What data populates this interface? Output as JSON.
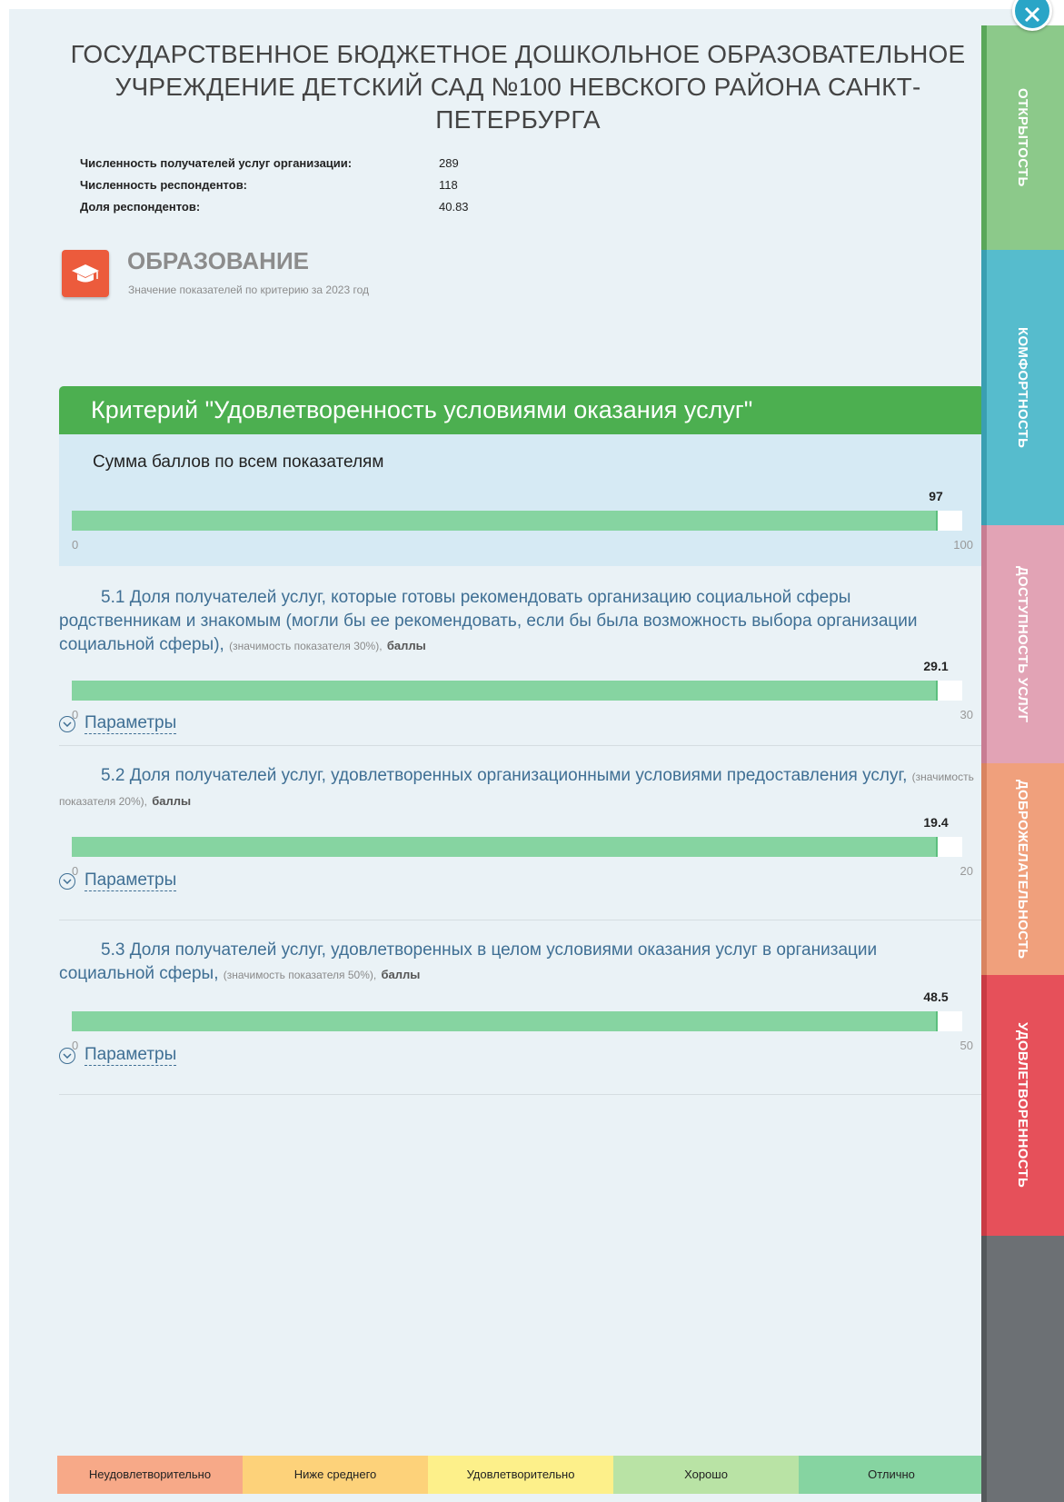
{
  "organization": {
    "title": "ГОСУДАРСТВЕННОЕ БЮДЖЕТНОЕ ДОШКОЛЬНОЕ ОБРАЗОВАТЕЛЬНОЕ УЧРЕЖДЕНИЕ ДЕТСКИЙ САД №100 НЕВСКОГО РАЙОНА САНКТ-ПЕТЕРБУРГА",
    "stats": [
      {
        "label": "Численность получателей услуг организации:",
        "value": "289"
      },
      {
        "label": "Численность респондентов:",
        "value": "118"
      },
      {
        "label": "Доля респондентов:",
        "value": "40.83"
      }
    ]
  },
  "section": {
    "icon": "graduation-cap-icon",
    "title": "ОБРАЗОВАНИЕ",
    "subtitle": "Значение показателей по критерию за 2023 год"
  },
  "criterion": {
    "title": "Критерий \"Удовлетворенность условиями оказания услуг\"",
    "summary": {
      "label": "Сумма баллов по всем показателям",
      "value": 97,
      "value_text": "97",
      "min": "0",
      "max": "100",
      "max_value": 100
    },
    "indicators": [
      {
        "text": "5.1 Доля получателей услуг, которые готовы рекомендовать организацию социальной сферы родственникам и знакомым (могли бы ее рекомендовать, если бы была возможность выбора организации социальной сферы),",
        "weight": "(значимость показателя 30%),",
        "unit": "баллы",
        "value": 29.1,
        "value_text": "29.1",
        "min": "0",
        "max": "30",
        "max_value": 30,
        "params_label": "Параметры"
      },
      {
        "text": "5.2 Доля получателей услуг, удовлетворенных организационными условиями предоставления услуг,",
        "weight": "(значимость показателя 20%),",
        "unit": "баллы",
        "value": 19.4,
        "value_text": "19.4",
        "min": "0",
        "max": "20",
        "max_value": 20,
        "params_label": "Параметры"
      },
      {
        "text": "5.3 Доля получателей услуг, удовлетворенных в целом условиями оказания услуг в организации социальной сферы,",
        "weight": "(значимость показателя 50%),",
        "unit": "баллы",
        "value": 48.5,
        "value_text": "48.5",
        "min": "0",
        "max": "50",
        "max_value": 50,
        "params_label": "Параметры"
      }
    ]
  },
  "legend": [
    {
      "label": "Неудовлетворительно",
      "color": "#f7a988"
    },
    {
      "label": "Ниже среднего",
      "color": "#fdd27a"
    },
    {
      "label": "Удовлетворительно",
      "color": "#fdf08a"
    },
    {
      "label": "Хорошо",
      "color": "#b9e3a5"
    },
    {
      "label": "Отлично",
      "color": "#86d4a1"
    }
  ],
  "tabs": [
    {
      "label": "ОТКРЫТОСТЬ",
      "color": "#8cc98a",
      "stripe": "#5aa75a"
    },
    {
      "label": "КОМФОРТНОСТЬ",
      "color": "#56bccd",
      "stripe": "#3a9fb2"
    },
    {
      "label": "ДОСТУПНОСТЬ УСЛУГ",
      "color": "#e2a3b5",
      "stripe": "#c87d93"
    },
    {
      "label": "ДОБРОЖЕЛАТЕЛЬНОСТЬ",
      "color": "#f0a07c",
      "stripe": "#d98460"
    },
    {
      "label": "УДОВЛЕТВОРЕННОСТЬ",
      "color": "#e6505a",
      "stripe": "#c93b44"
    },
    {
      "label": "",
      "color": "#6c7074",
      "stripe": "#55595c"
    }
  ]
}
